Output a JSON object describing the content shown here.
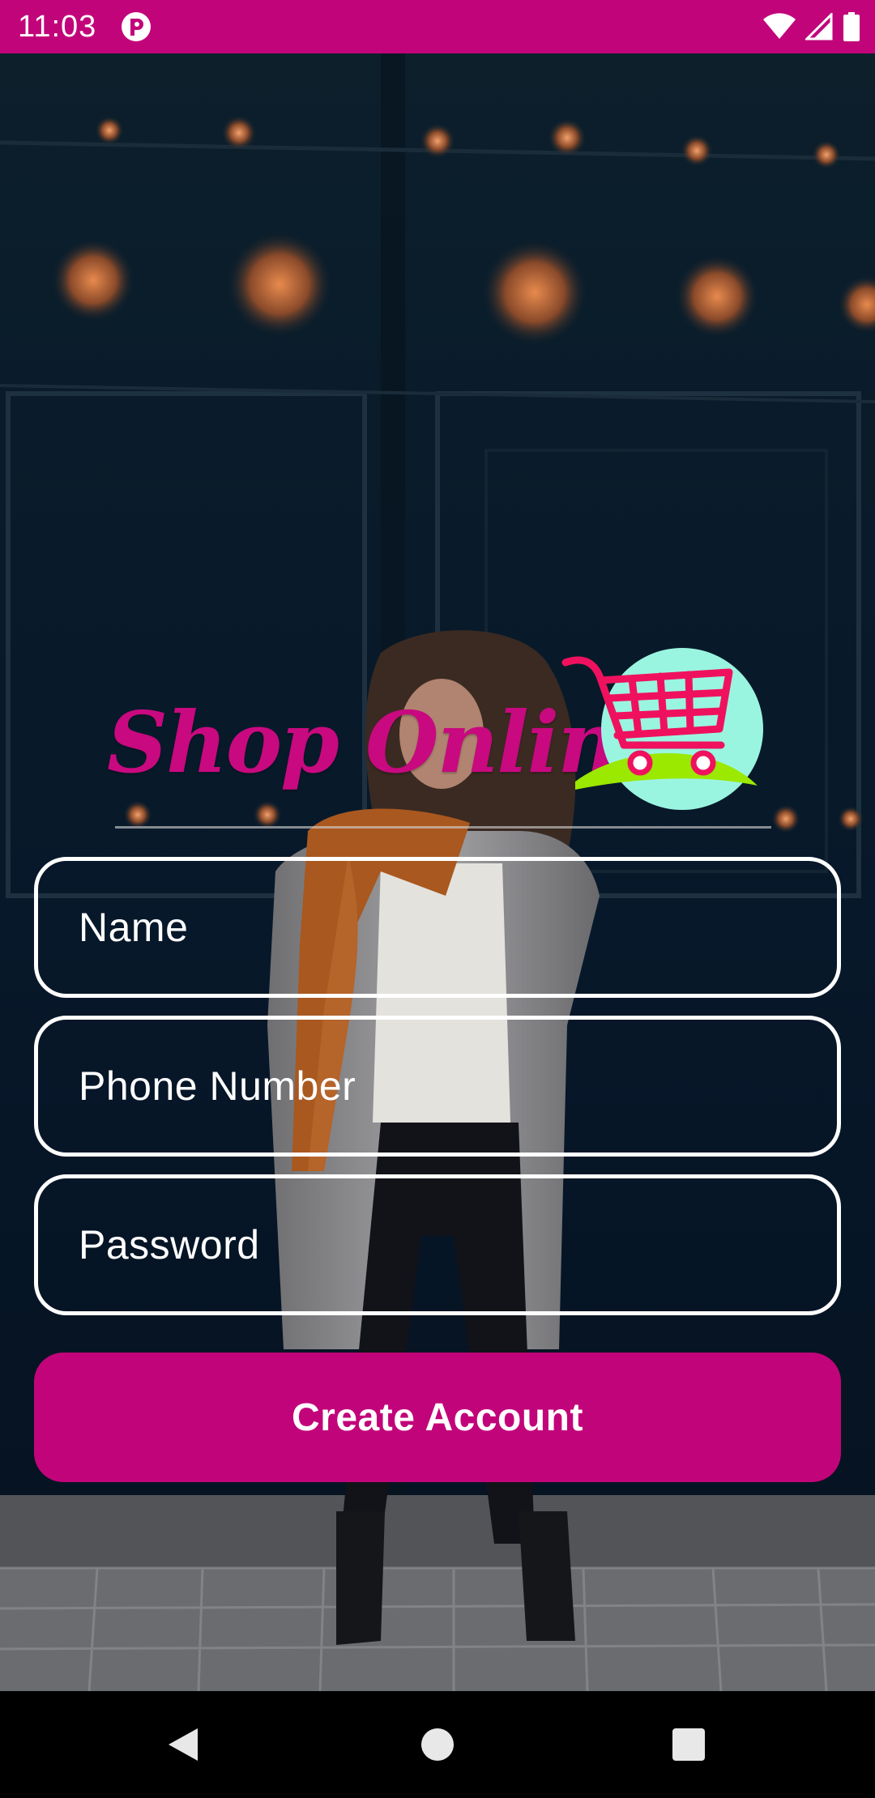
{
  "status_bar": {
    "time": "11:03",
    "icons": [
      "app-notification-icon",
      "wifi-icon",
      "cell-signal-icon",
      "battery-icon"
    ]
  },
  "logo": {
    "text": "Shop Online",
    "icon": "shopping-cart-icon"
  },
  "form": {
    "name_placeholder": "Name",
    "phone_placeholder": "Phone Number",
    "password_placeholder": "Password",
    "submit_label": "Create Account"
  },
  "nav_bar": {
    "icons": [
      "back-icon",
      "home-icon",
      "recents-icon"
    ]
  },
  "colors": {
    "brand": "#c2047a",
    "field_border": "#ffffff",
    "cart_red": "#f0115e",
    "cart_circle": "#9af5e0",
    "cart_base": "#9be800"
  }
}
